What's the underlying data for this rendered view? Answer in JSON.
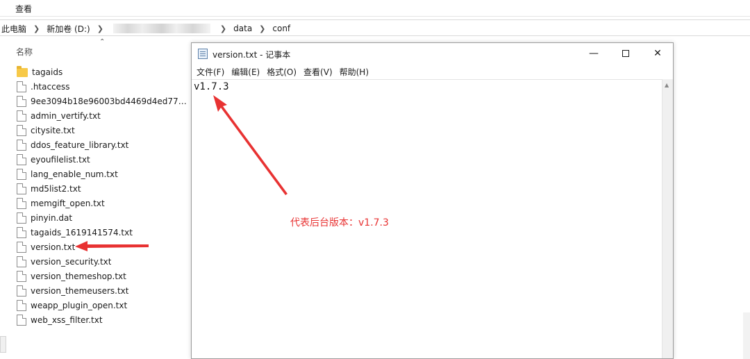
{
  "explorer": {
    "ribbon_tab": "查看",
    "breadcrumb": {
      "this_pc": "此电脑",
      "drive": "新加卷 (D:)",
      "folder_data": "data",
      "folder_conf": "conf"
    },
    "column_header": "名称",
    "files": [
      {
        "name": "tagaids",
        "type": "folder"
      },
      {
        "name": ".htaccess",
        "type": "file"
      },
      {
        "name": "9ee3094b18e96003bd4469d4ed7726...",
        "type": "file"
      },
      {
        "name": "admin_vertify.txt",
        "type": "file"
      },
      {
        "name": "citysite.txt",
        "type": "file"
      },
      {
        "name": "ddos_feature_library.txt",
        "type": "file"
      },
      {
        "name": "eyoufilelist.txt",
        "type": "file"
      },
      {
        "name": "lang_enable_num.txt",
        "type": "file"
      },
      {
        "name": "md5list2.txt",
        "type": "file"
      },
      {
        "name": "memgift_open.txt",
        "type": "file"
      },
      {
        "name": "pinyin.dat",
        "type": "file"
      },
      {
        "name": "tagaids_1619141574.txt",
        "type": "file"
      },
      {
        "name": "version.txt",
        "type": "file"
      },
      {
        "name": "version_security.txt",
        "type": "file"
      },
      {
        "name": "version_themeshop.txt",
        "type": "file"
      },
      {
        "name": "version_themeusers.txt",
        "type": "file"
      },
      {
        "name": "weapp_plugin_open.txt",
        "type": "file"
      },
      {
        "name": "web_xss_filter.txt",
        "type": "file"
      }
    ]
  },
  "notepad": {
    "title": "version.txt - 记事本",
    "menu": [
      "文件(F)",
      "编辑(E)",
      "格式(O)",
      "查看(V)",
      "帮助(H)"
    ],
    "content": "v1.7.3"
  },
  "annotation": {
    "label": "代表后台版本：v1.7.3",
    "color": "#e83232"
  }
}
